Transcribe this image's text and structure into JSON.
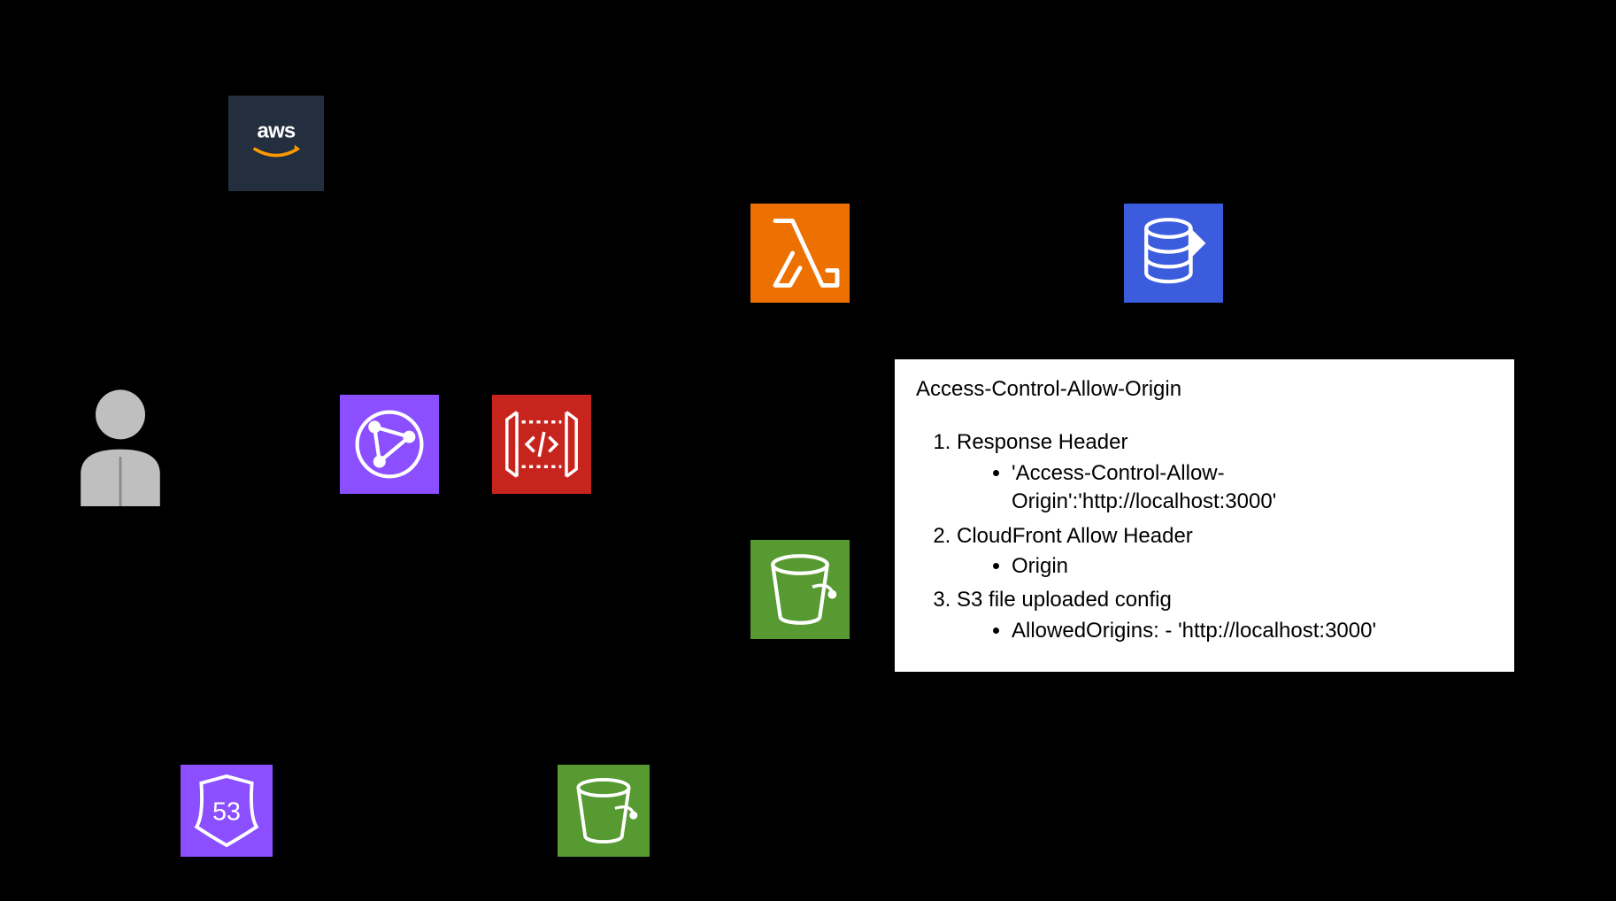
{
  "aws": {
    "label": "aws"
  },
  "note": {
    "title": "Access-Control-Allow-Origin",
    "items": [
      {
        "label": "Response Header",
        "bullets": [
          "'Access-Control-Allow-Origin':'http://localhost:3000'"
        ]
      },
      {
        "label": "CloudFront Allow Header",
        "bullets": [
          "Origin"
        ]
      },
      {
        "label": "S3 file uploaded config",
        "bullets": [
          "AllowedOrigins: - 'http://localhost:3000'"
        ]
      }
    ]
  },
  "icons": {
    "user": "user-icon",
    "aws_cloud": "aws-cloud-icon",
    "lambda": "lambda-icon",
    "dynamodb": "dynamodb-icon",
    "cloudfront": "cloudfront-icon",
    "api_gateway": "api-gateway-icon",
    "s3_upper": "s3-bucket-icon",
    "route53": "route53-icon",
    "s3_lower": "s3-bucket-icon"
  },
  "colors": {
    "lambda": "#ED7100",
    "dynamodb": "#3B5CDD",
    "cloudfront": "#8C4FFF",
    "api_gateway": "#E7157B",
    "s3": "#569A31",
    "route53": "#8C4FFF",
    "aws_tile": "#232F3E",
    "api_gateway_tile": "#C8241E"
  }
}
